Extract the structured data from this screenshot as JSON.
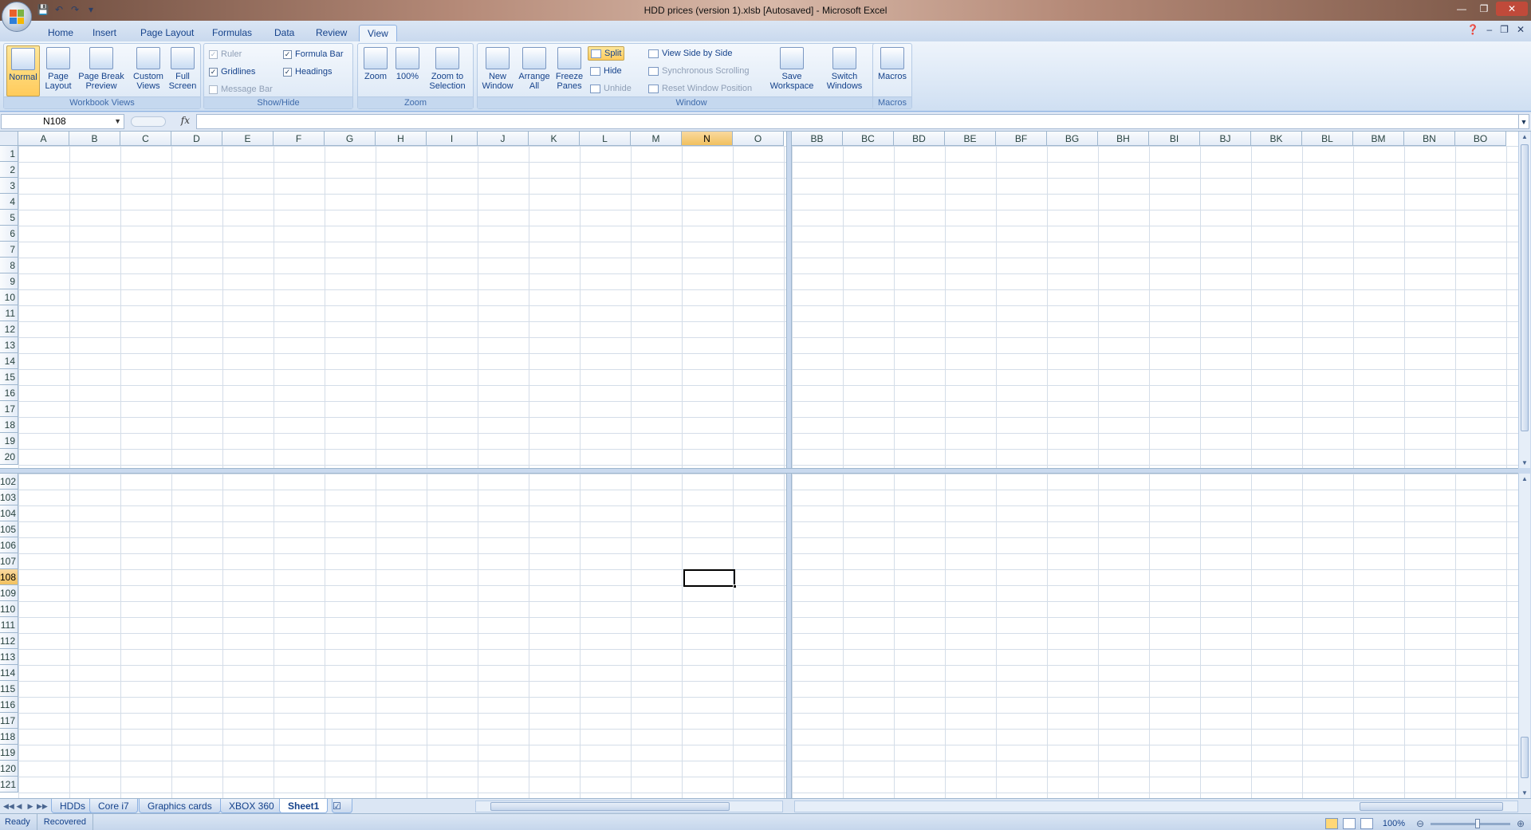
{
  "window": {
    "title": "HDD prices (version 1).xlsb [Autosaved] - Microsoft Excel",
    "qat": [
      "save-icon",
      "undo-icon",
      "redo-icon",
      "customize-icon"
    ]
  },
  "tabs": [
    "Home",
    "Insert",
    "Page Layout",
    "Formulas",
    "Data",
    "Review",
    "View"
  ],
  "active_tab": "View",
  "ribbon": {
    "workbook_views": {
      "label": "Workbook Views",
      "normal": "Normal",
      "page_layout": "Page Layout",
      "page_break": "Page Break Preview",
      "custom_views": "Custom Views",
      "full_screen": "Full Screen"
    },
    "show_hide": {
      "label": "Show/Hide",
      "ruler": "Ruler",
      "gridlines": "Gridlines",
      "message_bar": "Message Bar",
      "formula_bar": "Formula Bar",
      "headings": "Headings"
    },
    "zoom": {
      "label": "Zoom",
      "zoom": "Zoom",
      "hundred": "100%",
      "zoom_selection": "Zoom to Selection"
    },
    "window": {
      "label": "Window",
      "new_window": "New Window",
      "arrange_all": "Arrange All",
      "freeze_panes": "Freeze Panes",
      "split": "Split",
      "hide": "Hide",
      "unhide": "Unhide",
      "side_by_side": "View Side by Side",
      "sync_scroll": "Synchronous Scrolling",
      "reset_pos": "Reset Window Position",
      "save_workspace": "Save Workspace",
      "switch_windows": "Switch Windows"
    },
    "macros": {
      "label": "Macros",
      "macros": "Macros"
    }
  },
  "formula_bar": {
    "name_box": "N108",
    "fx": "fx",
    "value": ""
  },
  "columns_left": [
    "A",
    "B",
    "C",
    "D",
    "E",
    "F",
    "G",
    "H",
    "I",
    "J",
    "K",
    "L",
    "M",
    "N",
    "O"
  ],
  "columns_right": [
    "BB",
    "BC",
    "BD",
    "BE",
    "BF",
    "BG",
    "BH",
    "BI",
    "BJ",
    "BK",
    "BL",
    "BM",
    "BN",
    "BO"
  ],
  "rows_top": [
    1,
    2,
    3,
    4,
    5,
    6,
    7,
    8,
    9,
    10,
    11,
    12,
    13,
    14,
    15,
    16,
    17,
    18,
    19,
    20
  ],
  "rows_bottom": [
    102,
    103,
    104,
    105,
    106,
    107,
    108,
    109,
    110,
    111,
    112,
    113,
    114,
    115,
    116,
    117,
    118,
    119,
    120,
    121
  ],
  "selected_column": "N",
  "selected_row": 108,
  "sheets": [
    "HDDs",
    "Core i7",
    "Graphics cards",
    "XBOX 360",
    "Sheet1"
  ],
  "active_sheet": "Sheet1",
  "status": {
    "ready": "Ready",
    "recovered": "Recovered",
    "zoom": "100%"
  }
}
